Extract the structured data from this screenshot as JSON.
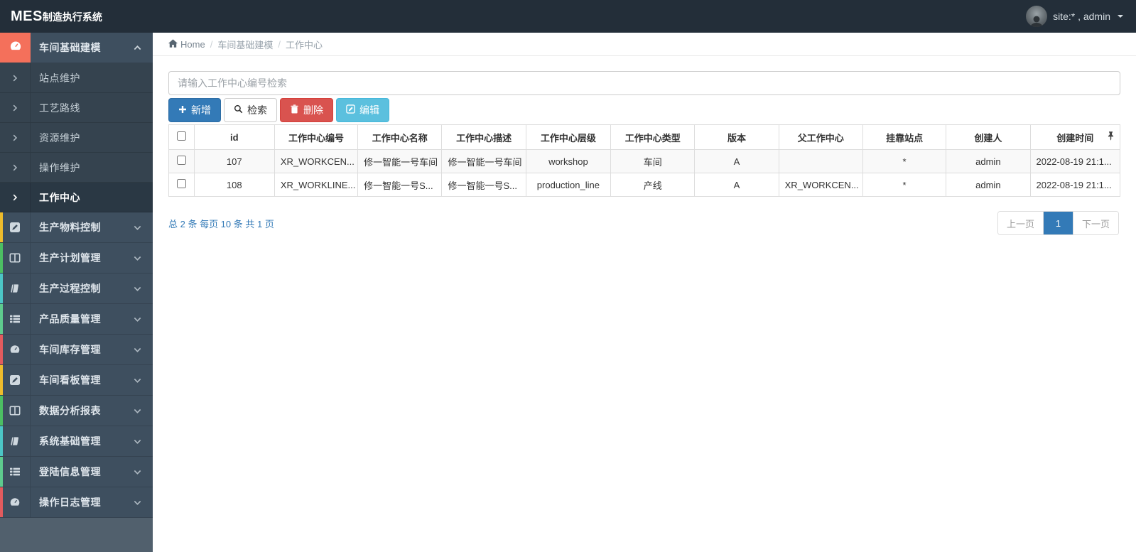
{
  "navbar": {
    "logo_bold": "MES",
    "logo_rest": "制造执行系统",
    "user_label": "site:* , admin"
  },
  "sidebar": {
    "section": {
      "label": "车间基础建模",
      "icon": "dashboard-icon",
      "accent": "#f4705b"
    },
    "submenu": [
      {
        "label": "站点维护",
        "active": false
      },
      {
        "label": "工艺路线",
        "active": false
      },
      {
        "label": "资源维护",
        "active": false
      },
      {
        "label": "操作维护",
        "active": false
      },
      {
        "label": "工作中心",
        "active": true
      }
    ],
    "items": [
      {
        "label": "生产物料控制",
        "icon": "edit-icon",
        "accent": "#eebc2c"
      },
      {
        "label": "生产计划管理",
        "icon": "columns-icon",
        "accent": "#4cbf63"
      },
      {
        "label": "生产过程控制",
        "icon": "book-icon",
        "accent": "#4cc6c6"
      },
      {
        "label": "产品质量管理",
        "icon": "th-list-icon",
        "accent": "#5ecb8e"
      },
      {
        "label": "车间库存管理",
        "icon": "dashboard-icon",
        "accent": "#e25b5e"
      },
      {
        "label": "车间看板管理",
        "icon": "edit-icon",
        "accent": "#eebc2c"
      },
      {
        "label": "数据分析报表",
        "icon": "columns-icon",
        "accent": "#4cbf63"
      },
      {
        "label": "系统基础管理",
        "icon": "book-icon",
        "accent": "#4cc6c6"
      },
      {
        "label": "登陆信息管理",
        "icon": "th-list-icon",
        "accent": "#5ecb8e"
      },
      {
        "label": "操作日志管理",
        "icon": "dashboard-icon",
        "accent": "#e25b5e"
      }
    ]
  },
  "breadcrumb": {
    "home": "Home",
    "level1": "车间基础建模",
    "level2": "工作中心"
  },
  "toolbar": {
    "search_placeholder": "请输入工作中心编号检索",
    "add_label": "新增",
    "search_label": "检索",
    "delete_label": "删除",
    "edit_label": "编辑"
  },
  "table": {
    "columns": [
      "id",
      "工作中心编号",
      "工作中心名称",
      "工作中心描述",
      "工作中心层级",
      "工作中心类型",
      "版本",
      "父工作中心",
      "挂靠站点",
      "创建人",
      "创建时间"
    ],
    "rows": [
      [
        "107",
        "XR_WORKCEN...",
        "修一智能一号车间",
        "修一智能一号车间",
        "workshop",
        "车间",
        "A",
        "",
        "*",
        "admin",
        "2022-08-19 21:1..."
      ],
      [
        "108",
        "XR_WORKLINE...",
        "修一智能一号S...",
        "修一智能一号S...",
        "production_line",
        "产线",
        "A",
        "XR_WORKCEN...",
        "*",
        "admin",
        "2022-08-19 21:1..."
      ]
    ]
  },
  "pagination": {
    "summary": "总 2 条  每页 10 条  共 1 页",
    "prev_label": "上一页",
    "page_label": "1",
    "next_label": "下一页"
  },
  "colors": {
    "navbar_bg": "#232e39",
    "sidebar_item_bg": "#3e4f5f",
    "sidebar_sub_bg": "#35434f",
    "sidebar_active_bg": "#2a3844",
    "primary": "#337ab7",
    "danger": "#d9534f",
    "info": "#5bc0de",
    "section_accent": "#f4705b"
  }
}
